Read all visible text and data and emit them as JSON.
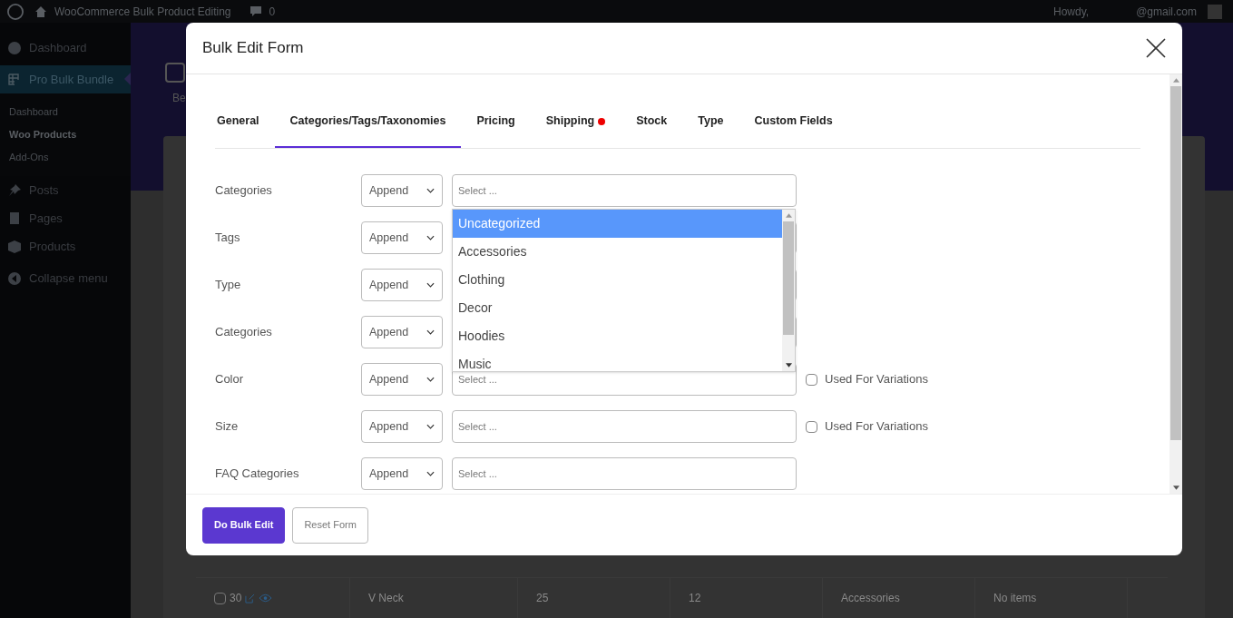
{
  "admin_bar": {
    "site_title": "WooCommerce Bulk Product Editing",
    "comments_count": "0",
    "greeting": "Howdy,",
    "account": "@gmail.com"
  },
  "sidebar": {
    "items": [
      {
        "kind": "dashboard",
        "label": "Dashboard",
        "selected": false
      },
      {
        "kind": "bulk",
        "label": "Pro Bulk Bundle",
        "selected": true,
        "children": [
          {
            "label": "Dashboard",
            "selected": false
          },
          {
            "label": "Woo Products",
            "selected": true
          },
          {
            "label": "Add-Ons",
            "selected": false
          }
        ]
      },
      {
        "kind": "posts",
        "label": "Posts",
        "selected": false
      },
      {
        "kind": "pages",
        "label": "Pages",
        "selected": false
      },
      {
        "kind": "products",
        "label": "Products",
        "selected": false
      },
      {
        "kind": "collapse",
        "label": "Collapse menu",
        "selected": false
      }
    ]
  },
  "background": {
    "toolbar_label": "Be",
    "table": {
      "rows": [
        {
          "checked": false,
          "cells": [
            "30",
            "V Neck",
            "25",
            "12",
            "Accessories",
            "No items"
          ]
        }
      ]
    }
  },
  "modal": {
    "title": "Bulk Edit Form",
    "tabs": [
      {
        "label": "General",
        "selected": false,
        "alert": false
      },
      {
        "label": "Categories/Tags/Taxonomies",
        "selected": true,
        "alert": false
      },
      {
        "label": "Pricing",
        "selected": false,
        "alert": false
      },
      {
        "label": "Shipping",
        "selected": false,
        "alert": true
      },
      {
        "label": "Stock",
        "selected": false,
        "alert": false
      },
      {
        "label": "Type",
        "selected": false,
        "alert": false
      },
      {
        "label": "Custom Fields",
        "selected": false,
        "alert": false
      }
    ],
    "fields": [
      {
        "kind": "plain",
        "label": "Categories",
        "mode": "Append",
        "placeholder": "Select ..."
      },
      {
        "kind": "plain",
        "label": "Tags",
        "mode": "Append"
      },
      {
        "kind": "plain",
        "label": "Type",
        "mode": "Append"
      },
      {
        "kind": "plain",
        "label": "Categories",
        "mode": "Append"
      },
      {
        "kind": "variation",
        "label": "Color",
        "mode": "Append",
        "placeholder": "Select ...",
        "variation_label": "Used For Variations",
        "checked": false
      },
      {
        "kind": "variation",
        "label": "Size",
        "mode": "Append",
        "placeholder": "Select ...",
        "variation_label": "Used For Variations",
        "checked": false
      },
      {
        "kind": "plain",
        "label": "FAQ Categories",
        "mode": "Append",
        "placeholder": "Select ..."
      }
    ],
    "dropdown": {
      "options": [
        {
          "label": "Uncategorized",
          "selected": true
        },
        {
          "label": "Accessories",
          "selected": false
        },
        {
          "label": "Clothing",
          "selected": false
        },
        {
          "label": "Decor",
          "selected": false
        },
        {
          "label": "Hoodies",
          "selected": false
        },
        {
          "label": "Music",
          "selected": false
        }
      ]
    },
    "buttons": [
      {
        "kind": "primary",
        "label": "Do Bulk Edit"
      },
      {
        "kind": "secondary",
        "label": "Reset Form"
      }
    ]
  }
}
